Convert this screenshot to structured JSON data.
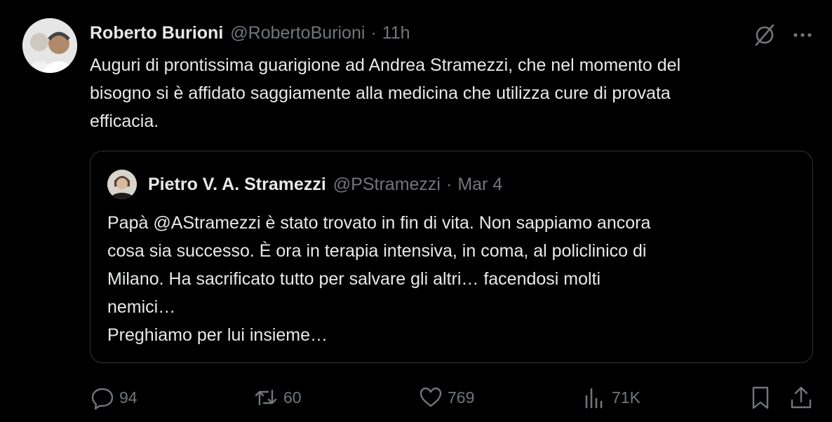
{
  "tweet": {
    "author_name": "Roberto Burioni",
    "author_handle": "@RobertoBurioni",
    "separator": "·",
    "time": "11h",
    "text_lines": [
      "Auguri di prontissima guarigione ad Andrea Stramezzi, che nel momento del",
      "bisogno si è affidato saggiamente alla medicina che utilizza cure di provata",
      "efficacia."
    ]
  },
  "quote": {
    "author_name": "Pietro V. A. Stramezzi",
    "author_handle": "@PStramezzi",
    "separator": "·",
    "date": "Mar 4",
    "text_lines": [
      "Papà @AStramezzi è stato trovato in fin di vita. Non sappiamo ancora",
      "cosa sia successo. È ora in terapia intensiva, in coma, al policlinico di",
      "Milano. Ha sacrificato tutto per salvare gli altri… facendosi molti",
      "nemici…",
      "Preghiamo per lui insieme…"
    ]
  },
  "actions": {
    "replies": "94",
    "reposts": "60",
    "likes": "769",
    "views": "71K"
  },
  "icons": {
    "reply": "reply-icon",
    "repost": "repost-icon",
    "like": "heart-icon",
    "views": "views-icon",
    "bookmark": "bookmark-icon",
    "share": "share-icon",
    "grok": "grok-icon",
    "more": "more-icon"
  },
  "colors": {
    "background": "#000000",
    "text": "#e7e9ea",
    "secondary": "#71767b",
    "border": "#2f3336"
  }
}
